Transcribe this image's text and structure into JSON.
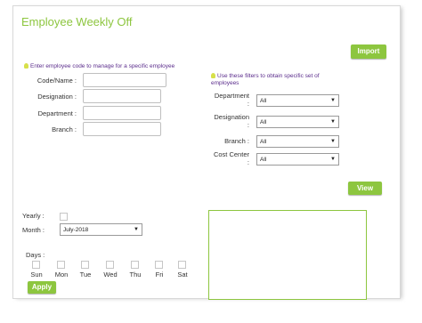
{
  "page": {
    "title": "Employee Weekly Off",
    "import_label": "Import",
    "view_label": "View",
    "apply_label": "Apply"
  },
  "left_filters": {
    "hint": "Enter employee code to manage for a specific employee",
    "code_label": "Code/Name :",
    "designation_label": "Designation :",
    "department_label": "Department :",
    "branch_label": "Branch :"
  },
  "right_filters": {
    "hint": "Use these filters to obtain specific set of employees",
    "department_label": "Department",
    "department_colon": ":",
    "department_value": "All",
    "designation_label": "Designation",
    "designation_colon": ":",
    "designation_value": "All",
    "branch_label": "Branch :",
    "branch_value": "All",
    "cost_center_label": "Cost Center",
    "cost_center_colon": ":",
    "cost_center_value": "All"
  },
  "schedule": {
    "yearly_label": "Yearly :",
    "month_label": "Month :",
    "month_value": "July-2018",
    "days_label": "Days :",
    "days": [
      "Sun",
      "Mon",
      "Tue",
      "Wed",
      "Thu",
      "Fri",
      "Sat"
    ]
  },
  "colors": {
    "accent": "#8dc63f",
    "hint_text": "#5b2d8c"
  },
  "icons": [
    "lightbulb-icon",
    "dropdown-arrow-icon"
  ]
}
